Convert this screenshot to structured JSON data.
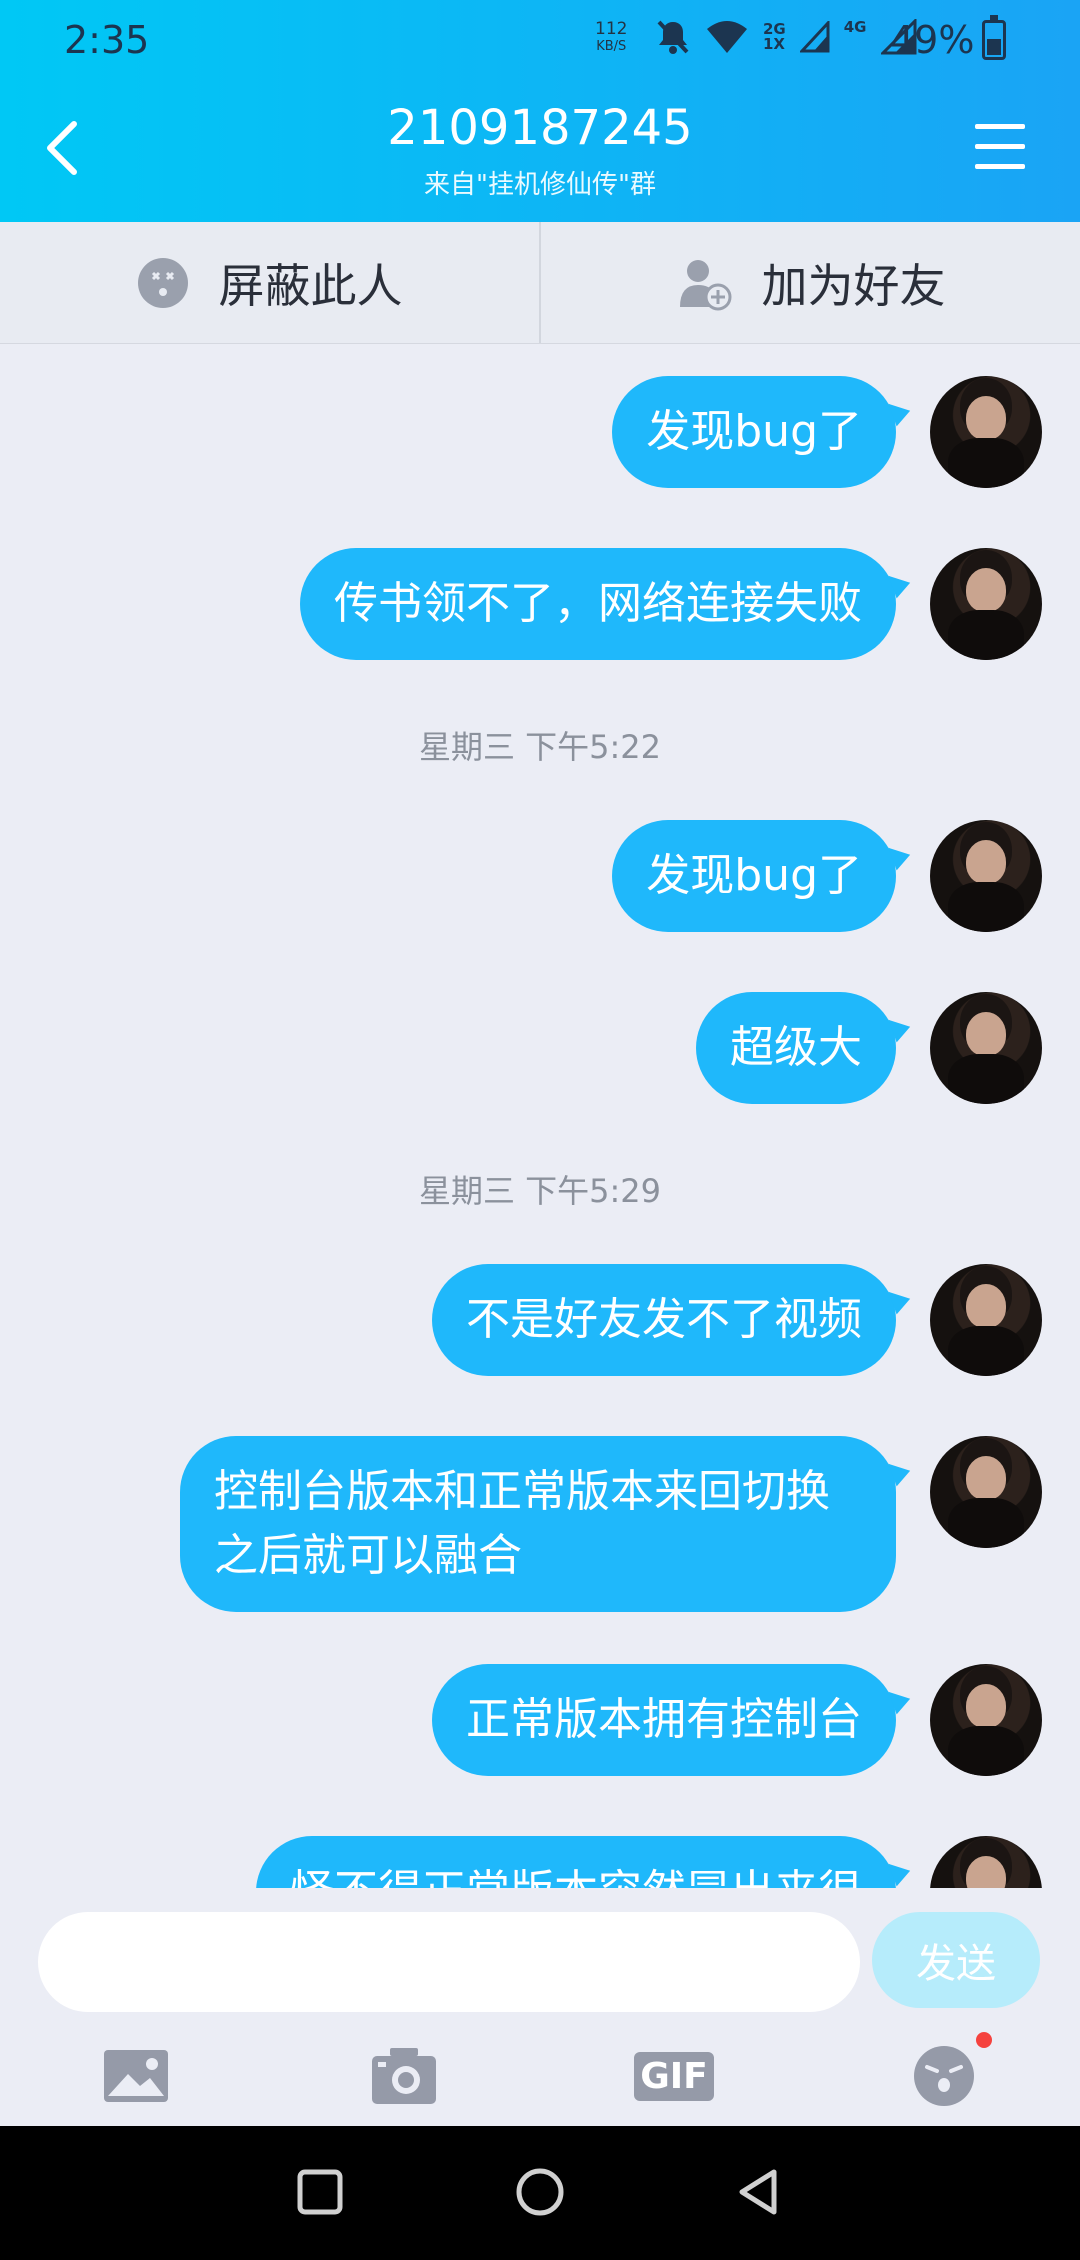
{
  "status_bar": {
    "time": "2:35",
    "speed_value": "112",
    "speed_unit": "KB/S",
    "network_1": "2G",
    "network_2": "1X",
    "network_3": "4G",
    "battery": "49%"
  },
  "header": {
    "title": "2109187245",
    "subtitle": "来自\"挂机修仙传\"群"
  },
  "actions": {
    "block": "屏蔽此人",
    "add_friend": "加为好友"
  },
  "messages": [
    {
      "type": "msg",
      "text": "发现bug了"
    },
    {
      "type": "msg",
      "text": "传书领不了，网络连接失败"
    },
    {
      "type": "time",
      "text": "星期三 下午5:22"
    },
    {
      "type": "msg",
      "text": "发现bug了"
    },
    {
      "type": "msg",
      "text": "超级大"
    },
    {
      "type": "time",
      "text": "星期三 下午5:29"
    },
    {
      "type": "msg",
      "text": "不是好友发不了视频"
    },
    {
      "type": "msg",
      "text": "控制台版本和正常版本来回切换之后就可以融合"
    },
    {
      "type": "msg",
      "text": "正常版本拥有控制台"
    },
    {
      "type": "msg",
      "text": "怪不得正常版本突然冒出来很"
    }
  ],
  "input": {
    "value": "",
    "send_label": "发送"
  },
  "toolbar": {
    "gif_label": "GIF"
  },
  "colors": {
    "header_start": "#00c8f5",
    "header_end": "#1aa4f5",
    "bubble": "#1fb8fb",
    "send_button": "#b6ecfb",
    "chat_bg": "#ebedf5"
  }
}
